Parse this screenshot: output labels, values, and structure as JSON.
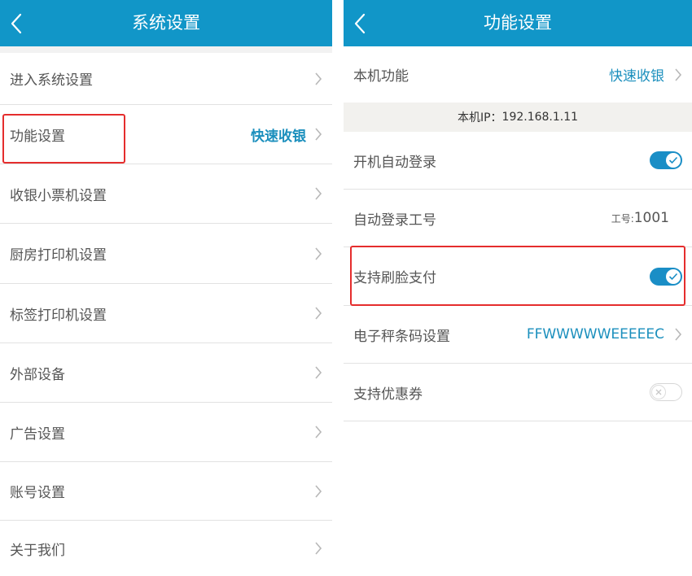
{
  "left_screen": {
    "title": "系统设置",
    "items": [
      {
        "label": "进入系统设置",
        "value": ""
      },
      {
        "label": "功能设置",
        "value": "快速收银"
      },
      {
        "label": "收银小票机设置",
        "value": ""
      },
      {
        "label": "厨房打印机设置",
        "value": ""
      },
      {
        "label": "标签打印机设置",
        "value": ""
      },
      {
        "label": "外部设备",
        "value": ""
      },
      {
        "label": "广告设置",
        "value": ""
      },
      {
        "label": "账号设置",
        "value": ""
      },
      {
        "label": "关于我们",
        "value": ""
      }
    ]
  },
  "right_screen": {
    "title": "功能设置",
    "local_function": {
      "label": "本机功能",
      "value": "快速收银"
    },
    "ip": {
      "label": "本机IP：",
      "value": "192.168.1.11"
    },
    "auto_login": {
      "label": "开机自动登录",
      "toggle_on": true
    },
    "auto_login_id": {
      "label": "自动登录工号",
      "prefix": "工号:",
      "value": "1001"
    },
    "face_pay": {
      "label": "支持刷脸支付",
      "toggle_on": true
    },
    "scale_barcode": {
      "label": "电子秤条码设置",
      "value": "FFWWWWWEEEEEC"
    },
    "coupon": {
      "label": "支持优惠券",
      "toggle_on": false
    }
  },
  "colors": {
    "header": "#1196c8",
    "accent_text": "#1b8fbd",
    "toggle_on": "#1a8ec6",
    "highlight_box": "#e52d2d"
  },
  "icons": [
    "back-arrow-icon",
    "chevron-right-icon",
    "toggle-check-icon",
    "toggle-x-icon"
  ]
}
